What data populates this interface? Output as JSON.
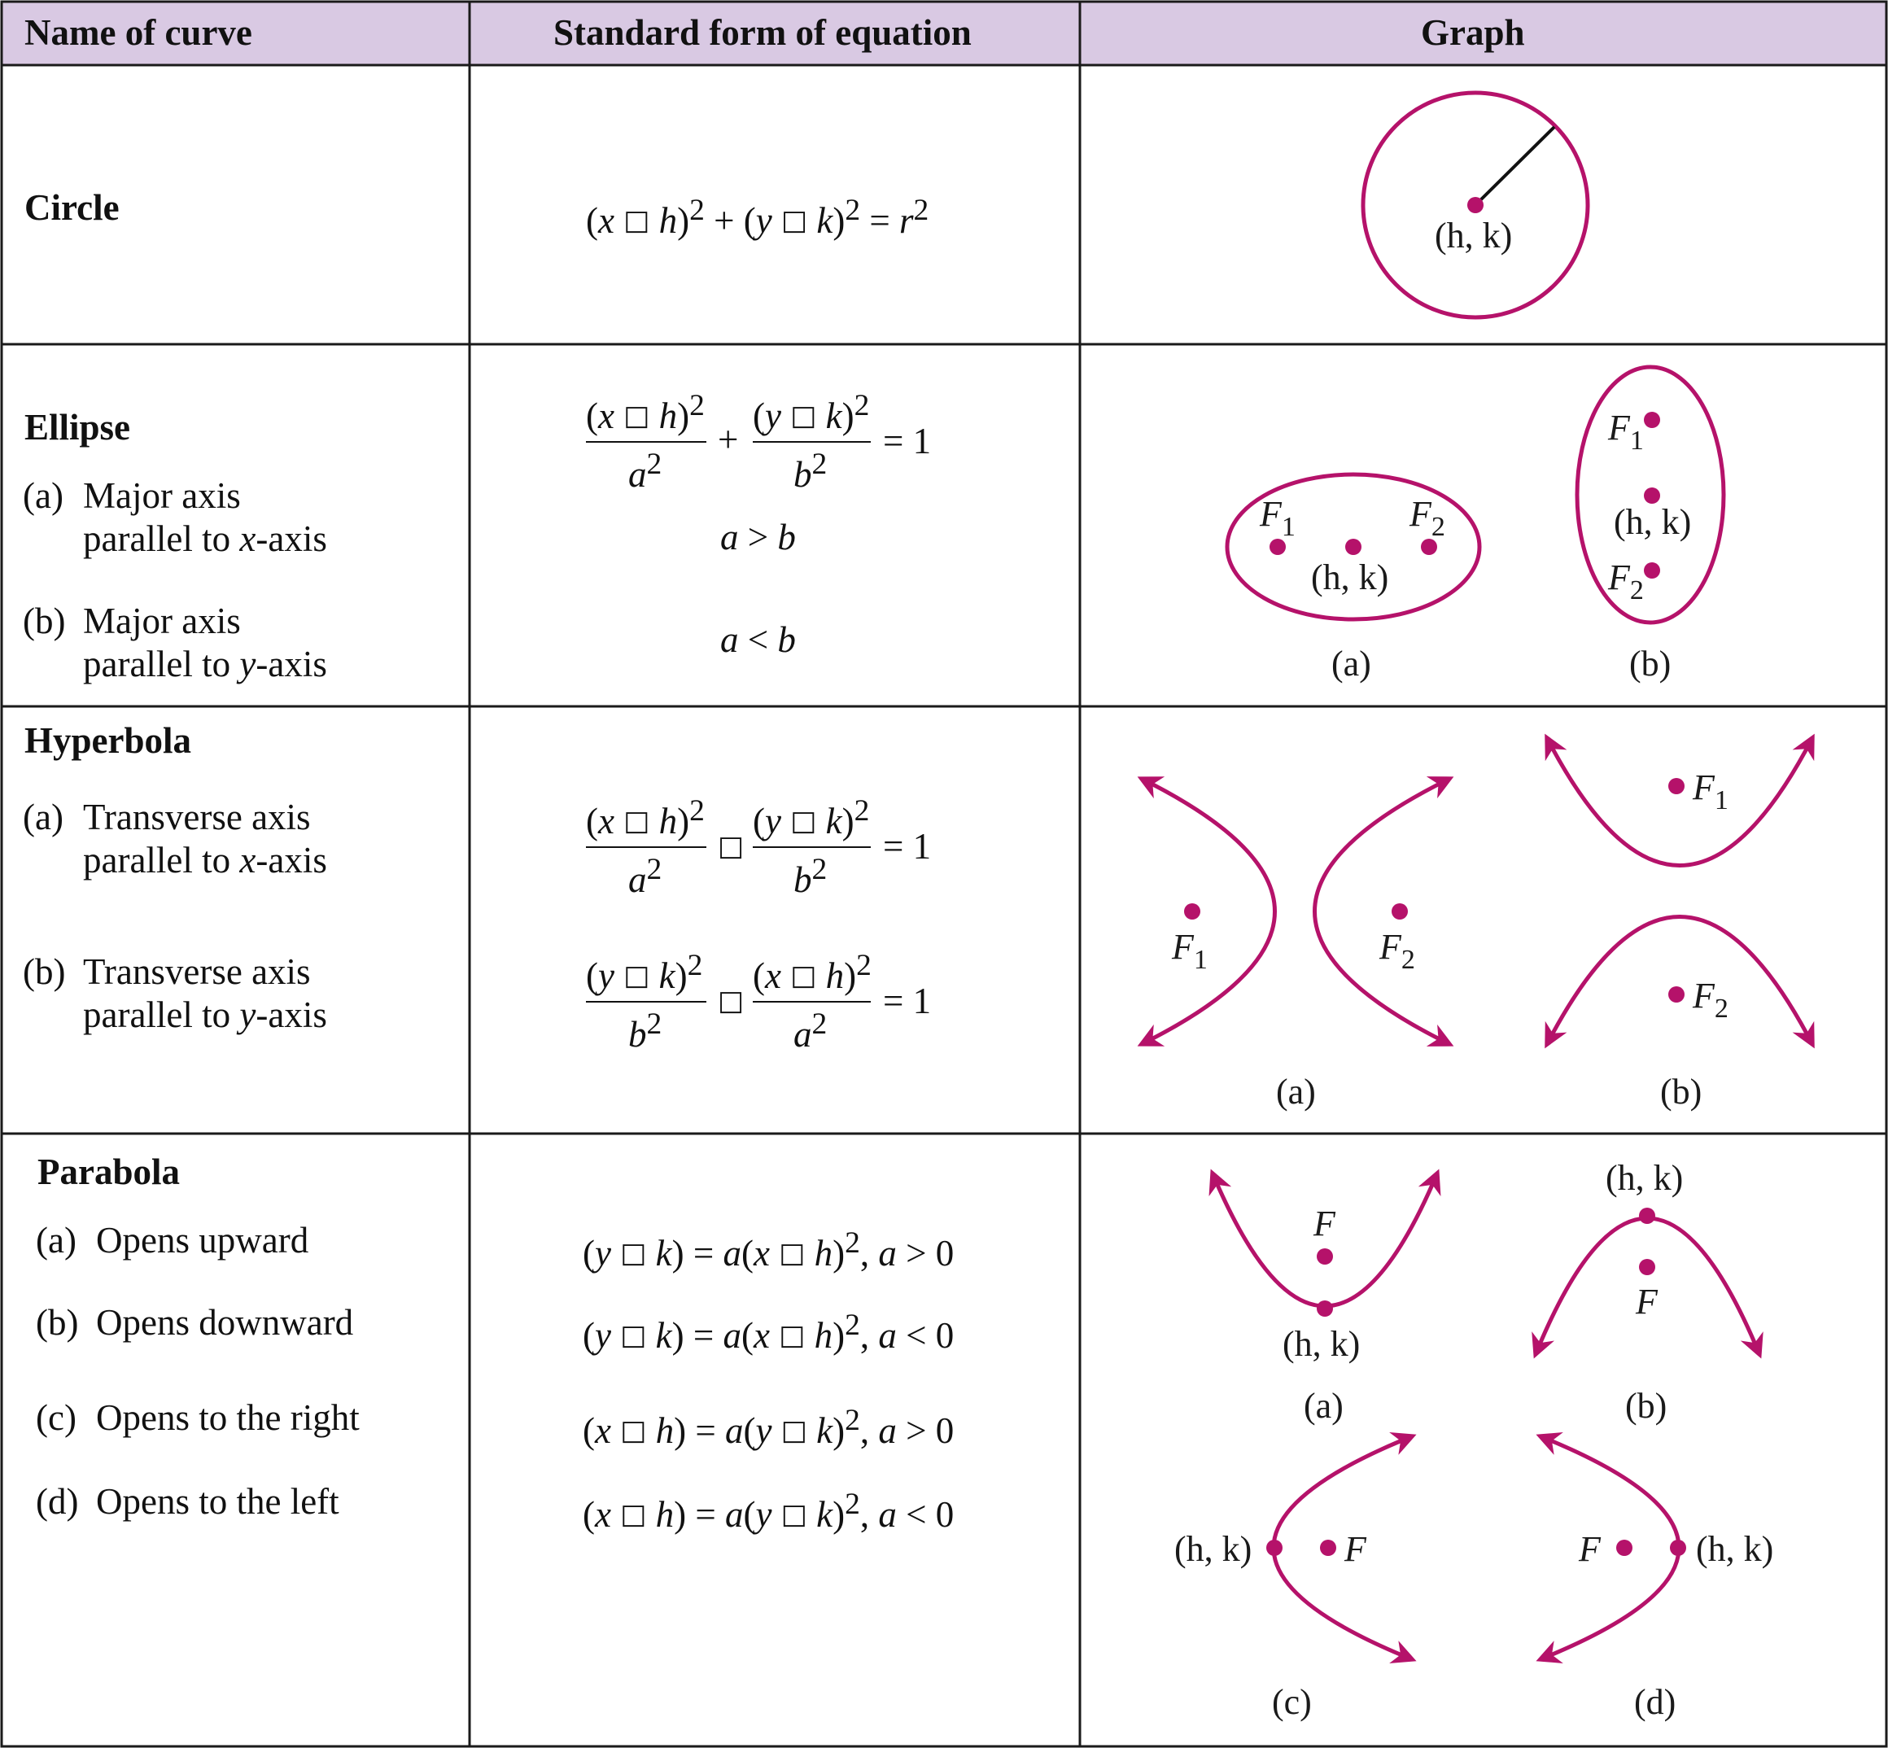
{
  "header": {
    "col1": "Name of curve",
    "col2": "Standard form of equation",
    "col3": "Graph"
  },
  "colors": {
    "header_bg": "#d9c9e3",
    "curve": "#b5126a",
    "border": "#1a1a1a"
  },
  "symbols": {
    "missing_op": "□",
    "plus": "+",
    "eq": "="
  },
  "circle": {
    "name": "Circle",
    "equation": "(x □ h)² + (y □ k)² = r²",
    "graph_label": "(h, k)"
  },
  "ellipse": {
    "name": "Ellipse",
    "a_label": "(a)",
    "a_text_1": "Major axis",
    "a_text_2": "parallel to x-axis",
    "b_label": "(b)",
    "b_text_1": "Major axis",
    "b_text_2": "parallel to y-axis",
    "equation": "(x □ h)²/a² + (y □ k)²/b² = 1",
    "cond_a": "a > b",
    "cond_b": "a < b",
    "graph_caption_a": "(a)",
    "graph_caption_b": "(b)",
    "graph_center": "(h, k)"
  },
  "hyperbola": {
    "name": "Hyperbola",
    "a_label": "(a)",
    "a_text_1": "Transverse axis",
    "a_text_2": "parallel to x-axis",
    "b_label": "(b)",
    "b_text_1": "Transverse axis",
    "b_text_2": "parallel to y-axis",
    "equation_a": "(x □ h)²/a² □ (y □ k)²/b² = 1",
    "equation_b": "(y □ k)²/b² □ (x □ h)²/a² = 1",
    "graph_caption_a": "(a)",
    "graph_caption_b": "(b)"
  },
  "parabola": {
    "name": "Parabola",
    "items": [
      {
        "label": "(a)",
        "text": "Opens upward",
        "equation": "(y □ k) = a(x □ h)², a > 0"
      },
      {
        "label": "(b)",
        "text": "Opens downward",
        "equation": "(y □ k) = a(x □ h)², a < 0"
      },
      {
        "label": "(c)",
        "text": "Opens to the right",
        "equation": "(x □ h) = a(y □ k)², a > 0"
      },
      {
        "label": "(d)",
        "text": "Opens to the left",
        "equation": "(x □ h) = a(y □ k)², a < 0"
      }
    ],
    "graph_captions": [
      "(a)",
      "(b)",
      "(c)",
      "(d)"
    ],
    "vertex": "(h, k)",
    "focus": "F"
  }
}
